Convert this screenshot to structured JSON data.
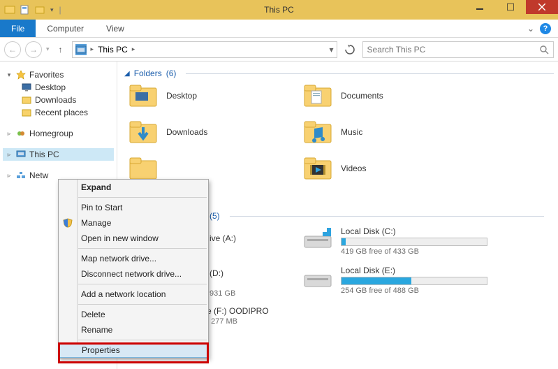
{
  "titlebar": {
    "title": "This PC"
  },
  "window_buttons": {
    "minimize": "–",
    "maximize": "□",
    "close": "✕"
  },
  "ribbon": {
    "file": "File",
    "tabs": [
      "Computer",
      "View"
    ],
    "chevron": "⌄",
    "help": "?"
  },
  "nav": {
    "breadcrumb": {
      "current": "This PC"
    },
    "search_placeholder": "Search This PC"
  },
  "sidebar": {
    "favorites": {
      "label": "Favorites",
      "items": [
        "Desktop",
        "Downloads",
        "Recent places"
      ]
    },
    "homegroup": {
      "label": "Homegroup"
    },
    "thispc": {
      "label": "This PC"
    },
    "network": {
      "label": "Netw"
    }
  },
  "sections": {
    "folders": {
      "title": "Folders",
      "count": "(6)"
    },
    "devices": {
      "title_suffix": "(5)"
    }
  },
  "folders": [
    {
      "label": "Desktop"
    },
    {
      "label": "Documents"
    },
    {
      "label": "Downloads"
    },
    {
      "label": "Music"
    },
    {
      "label": ""
    },
    {
      "label": "Videos"
    }
  ],
  "drives": {
    "a": {
      "name": "ive (A:)"
    },
    "c": {
      "name": "Local Disk (C:)",
      "sub": "419 GB free of 433 GB",
      "pct": 3
    },
    "d": {
      "name": "(D:)",
      "sub": "931 GB"
    },
    "e": {
      "name": "Local Disk (E:)",
      "sub": "254 GB free of 488 GB",
      "pct": 48
    },
    "f": {
      "name": "e (F:) OODIPRO",
      "sub": "f 277 MB"
    }
  },
  "context_menu": {
    "expand": "Expand",
    "pin": "Pin to Start",
    "manage": "Manage",
    "open_new": "Open in new window",
    "map": "Map network drive...",
    "disconnect": "Disconnect network drive...",
    "add_loc": "Add a network location",
    "delete": "Delete",
    "rename": "Rename",
    "properties": "Properties"
  }
}
